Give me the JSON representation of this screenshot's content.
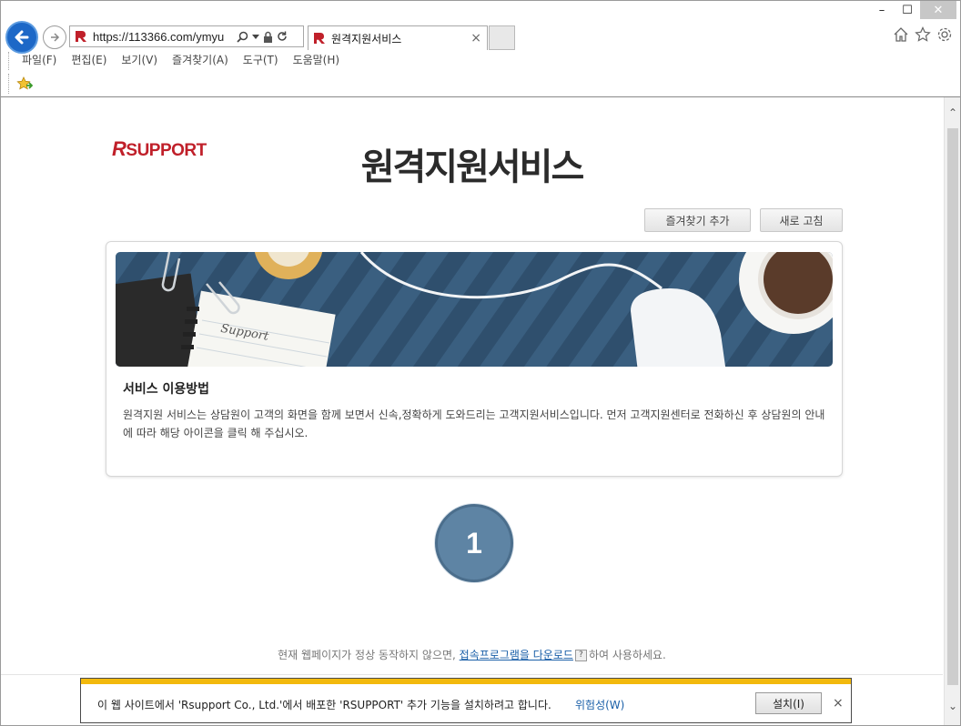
{
  "browser": {
    "url": "https://113366.com/ymyu",
    "tab_title": "원격지원서비스",
    "tab_close": "×",
    "window_min": "–",
    "window_max": "☐",
    "window_close": "✕",
    "menu": [
      "파일(F)",
      "편집(E)",
      "보기(V)",
      "즐겨찾기(A)",
      "도구(T)",
      "도움말(H)"
    ]
  },
  "page": {
    "logo_r": "R",
    "logo_text": "SUPPORT",
    "title": "원격지원서비스",
    "favorite_button": "즐겨찾기 추가",
    "refresh_button": "새로 고침",
    "card_title": "서비스 이용방법",
    "card_desc": "원격지원 서비스는 상담원이 고객의 화면을 함께 보면서 신속,정확하게 도와드리는 고객지원서비스입니다. 먼저 고객지원센터로 전화하신 후 상담원의 안내에 따라 해당 아이콘을 클릭 해 주십시오.",
    "banner_text": "Support",
    "step_number": "1",
    "footer_prefix": "현재 웹페이지가 정상 동작하지 않으면,",
    "footer_link": "접속프로그램을 다운로드",
    "footer_help": "?",
    "footer_suffix": "하여 사용하세요."
  },
  "infobar": {
    "message": "이 웹 사이트에서 'Rsupport Co., Ltd.'에서 배포한 'RSUPPORT' 추가 기능을 설치하려고 합니다.",
    "risk_link": "위험성(W)",
    "install_button": "설치(I)",
    "close": "×"
  },
  "colors": {
    "brand_red": "#c0202a",
    "step_blue": "#5e84a4",
    "infobar_stripe": "#f2b90d",
    "link_blue": "#1a5fa8"
  }
}
